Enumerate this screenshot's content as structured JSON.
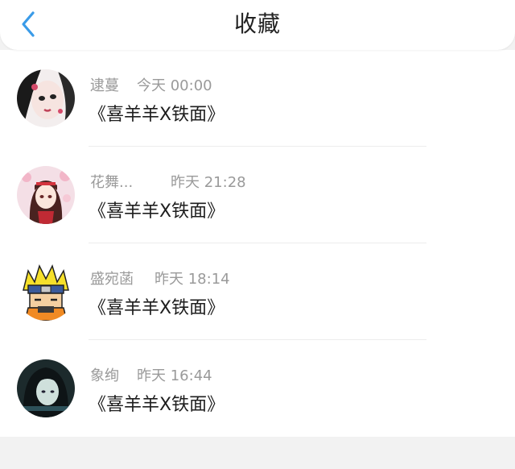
{
  "header": {
    "title": "收藏",
    "back_icon": "chevron-left-icon",
    "accent": "#3a9be8"
  },
  "favorites": [
    {
      "name": "逮蔓",
      "time": "今天 00:00",
      "content": "《喜羊羊X铁面》",
      "avatar": "avatar-doll-girl"
    },
    {
      "name": "花舞...",
      "time": "昨天 21:28",
      "content": "《喜羊羊X铁面》",
      "avatar": "avatar-anime-girl-sakura"
    },
    {
      "name": "盛宛菡",
      "time": "昨天 18:14",
      "content": "《喜羊羊X铁面》",
      "avatar": "avatar-naruto"
    },
    {
      "name": "象绚",
      "time": "昨天 16:44",
      "content": "《喜羊羊X铁面》",
      "avatar": "avatar-dark-haired-girl"
    }
  ]
}
